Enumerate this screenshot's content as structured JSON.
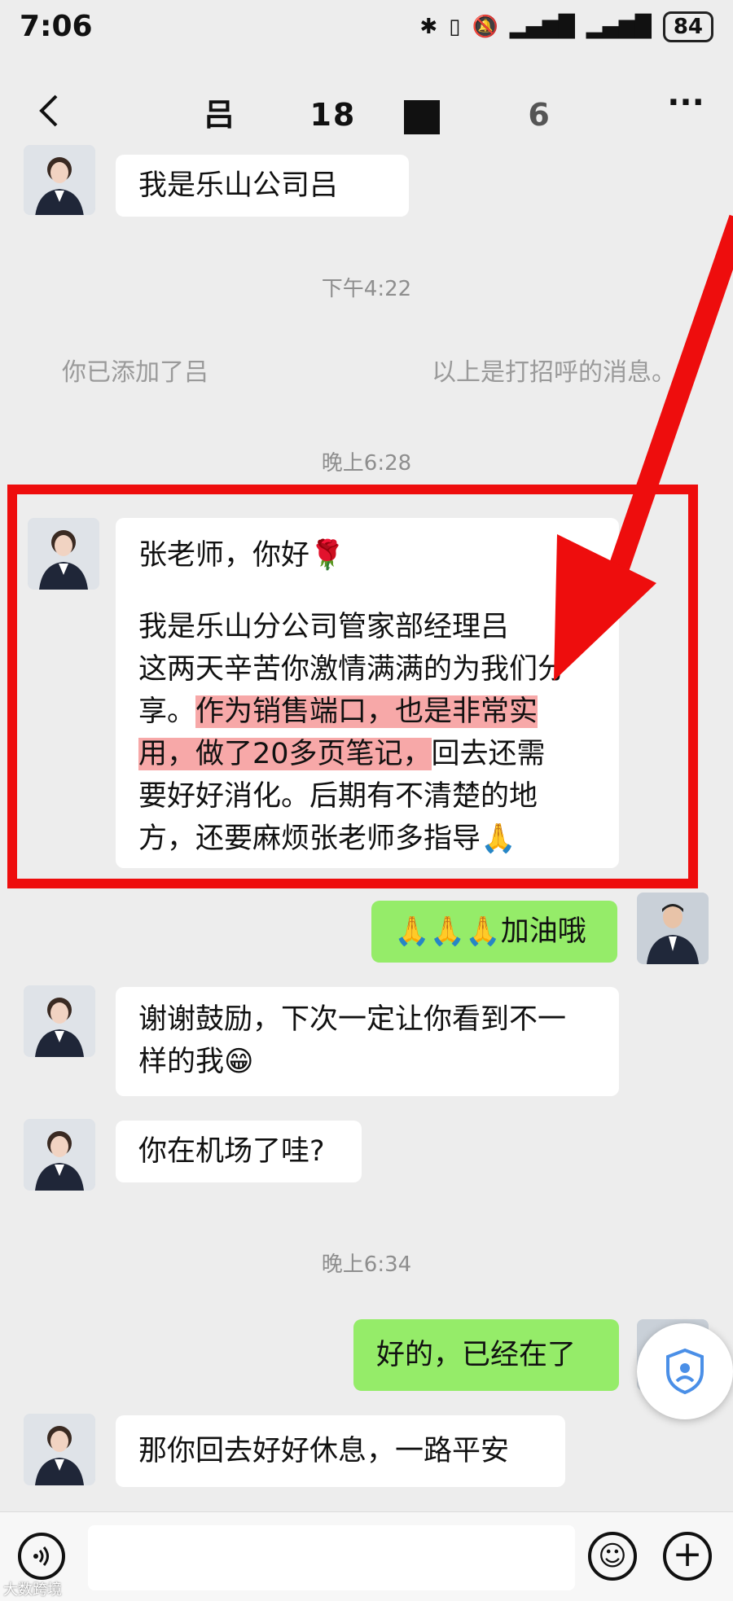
{
  "status_bar": {
    "time": "7:06",
    "battery": "84",
    "icons": [
      "bluetooth-icon",
      "vibrate-icon",
      "mute-bell-icon",
      "signal-icon",
      "signal-icon",
      "battery-icon"
    ]
  },
  "header": {
    "title_part1": "吕",
    "title_part2": "18",
    "title_part3": "6"
  },
  "messages": {
    "m1": "我是乐山公司吕",
    "ts1": "下午4:22",
    "sys_left": "你已添加了吕",
    "sys_right": "以上是打招呼的消息。",
    "ts2": "晚上6:28",
    "m2_greeting": "张老师，你好🌹",
    "m2_p1": "我是乐山分公司管家部经理吕",
    "m2_p2": "这两天辛苦你激情满满的为我们分",
    "m2_p3a": "享。",
    "m2_p3b": "作为销售端口，也是非常实",
    "m2_p4a": "用，做了20多页笔记，",
    "m2_p4b": "回去还需",
    "m2_p5": "要好好消化。后期有不清楚的地",
    "m2_p6": "方，还要麻烦张老师多指导🙏",
    "m3": "🙏🙏🙏加油哦",
    "m4_l1": "谢谢鼓励，下次一定让你看到不一",
    "m4_l2": "样的我😁",
    "m5": "你在机场了哇?",
    "ts3": "晚上6:34",
    "m6": "好的，已经在了",
    "m7": "那你回去好好休息，一路平安"
  },
  "watermark": "大数跨境",
  "colors": {
    "annotation_red": "#ee0d0d",
    "my_bubble": "#95ec69",
    "highlight": "#f7a8a8"
  }
}
